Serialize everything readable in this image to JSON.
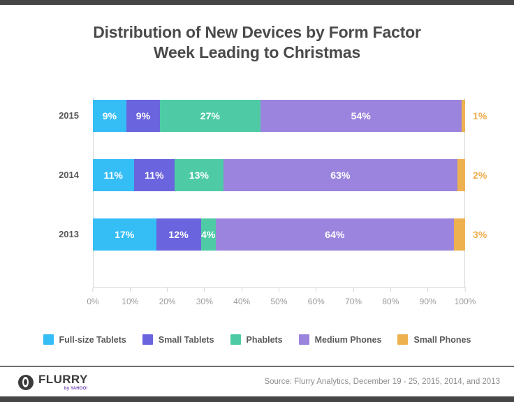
{
  "chart_data": {
    "type": "bar",
    "orientation": "horizontal",
    "stacked": true,
    "stacked_percent": true,
    "title": "Distribution of New Devices by Form Factor",
    "subtitle": "Week Leading to Christmas",
    "xlabel": "",
    "ylabel": "",
    "xlim": [
      0,
      100
    ],
    "grid": false,
    "legend_position": "bottom",
    "categories": [
      "2015",
      "2014",
      "2013"
    ],
    "xticks": [
      "0%",
      "10%",
      "20%",
      "30%",
      "40%",
      "50%",
      "60%",
      "70%",
      "80%",
      "90%",
      "100%"
    ],
    "xtick_values": [
      0,
      10,
      20,
      30,
      40,
      50,
      60,
      70,
      80,
      90,
      100
    ],
    "series": [
      {
        "name": "Full-size Tablets",
        "color": "#35bdf5",
        "values": [
          9,
          11,
          17
        ],
        "labels": [
          "9%",
          "11%",
          "17%"
        ],
        "label_position": "inside"
      },
      {
        "name": "Small Tablets",
        "color": "#6a64de",
        "values": [
          9,
          11,
          12
        ],
        "labels": [
          "9%",
          "11%",
          "12%"
        ],
        "label_position": "inside"
      },
      {
        "name": "Phablets",
        "color": "#4ecba5",
        "values": [
          27,
          13,
          4
        ],
        "labels": [
          "27%",
          "13%",
          "4%"
        ],
        "label_position": "inside"
      },
      {
        "name": "Medium Phones",
        "color": "#9b84de",
        "values": [
          54,
          63,
          64
        ],
        "labels": [
          "54%",
          "63%",
          "64%"
        ],
        "label_position": "inside"
      },
      {
        "name": "Small Phones",
        "color": "#eeb14f",
        "values": [
          1,
          2,
          3
        ],
        "labels": [
          "1%",
          "2%",
          "3%"
        ],
        "label_position": "outside"
      }
    ]
  },
  "footer": {
    "logo_word": "FLURRY",
    "logo_sub": "by YAHOO!",
    "source": "Source: Flurry Analytics, December 19 - 25, 2015, 2014, and 2013"
  }
}
